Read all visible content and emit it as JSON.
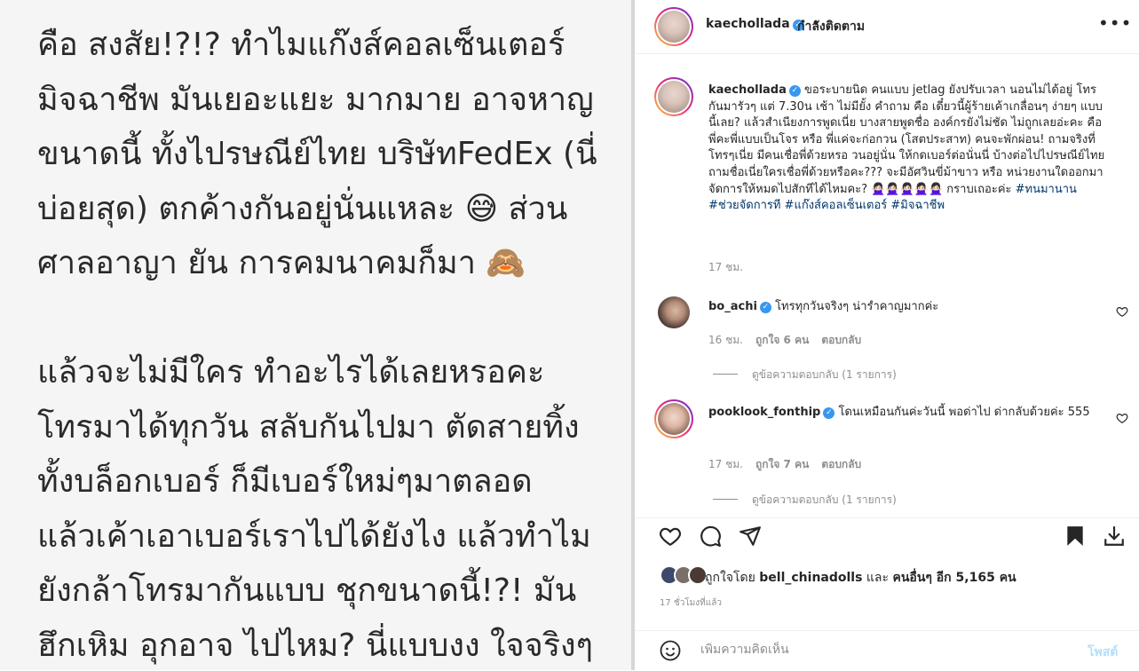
{
  "left_panel": {
    "text": "คือ สงสัย!?!? ทำไมแก๊งส์คอลเซ็นเตอร์\nมิจฉาชีพ มันเยอะแยะ มากมาย อาจหาญ\nขนาดนี้ ทั้งไปรษณีย์ไทย บริษัทFedEx (นี่\nบ่อยสุด) ตกค้างกันอยู่นั่นแหละ 😅 ส่วน\nศาลอาญา ยัน การคมนาคมก็มา 🙈\n\nแล้วจะไม่มีใคร ทำอะไรได้เลยหรอคะ\nโทรมาได้ทุกวัน สลับกันไปมา ตัดสายทิ้ง\nทั้งบล็อกเบอร์ ก็มีเบอร์ใหม่ๆมาตลอด\nแล้วเค้าเอาเบอร์เราไปได้ยังไง แล้วทำไม\nยังกล้าโทรมากันแบบ ชุกขนาดนี้!?! มัน\nฮึกเหิม อุกอาจ ไปไหม? นี่แบบงง ใจจริงๆ"
  },
  "header": {
    "username": "kaechollada",
    "separator": "•",
    "follow_status": "กำลังติดตาม",
    "more_icon": "more-horizontal-icon"
  },
  "caption": {
    "username": "kaechollada",
    "text": "ขอระบายนิด คนแบบ jetlag ยังปรับเวลา นอนไม่ได้อยู่ โทรกันมารัวๆ แต่ 7.30น เช้า ไม่มียั้ง คำถาม คือ เดี๋ยวนี้ผู้ร้ายเค้าเกลื่อนๆ ง่ายๆ แบบนี้เลย? แล้วสำเนียงการพูดเนี่ย บางสายพูดชื่อ องค์กรยังไม่ชัด ไม่ถูกเลยอ่ะคะ คือ พี่คะพี่แบบเป็นโจร หรือ พี่แค่จะก่อกวน (โสตประสาท) คนจะพักผ่อน! ถามจริงที่โทรๆเนี่ย มีคนเชื่อพี่ด้วยหรอ วนอยู่นั่น ให้กดเบอร์ต่อนั่นนี่ บ้างต่อไปไปรษณีย์ไทย ถามชื่อเนี่ยใครเชื่อพี่ด้วยหรือคะ??? จะมีอัศวินขี่ม้าขาว หรือ หน่วยงานใดออกมาจัดการให้หมดไปสักทีได้ไหมคะ? 🙅🏻‍♀️🙅🏻‍♀️🙅🏻‍♀️🙅🏻‍♀️🙅🏻‍♀️ กราบเถอะค่ะ",
    "hashtags": "#ทนมานาน #ช่วยจัดการที #แก๊งส์คอลเซ็นเตอร์ #มิจฉาชีพ",
    "time": "17 ชม."
  },
  "comments": [
    {
      "username": "bo_achi",
      "text": "โทรทุกวันจริงๆ น่ารำคาญมากค่ะ",
      "time": "16 ชม.",
      "likes": "ถูกใจ 6 คน",
      "reply": "ตอบกลับ",
      "view_replies": "ดูข้อความตอบกลับ (1 รายการ)"
    },
    {
      "username": "pooklook_fonthip",
      "text": "โดนเหมือนกันค่ะวันนี้ พอด่าไป ด่ากลับด้วยค่ะ 555",
      "time": "17 ชม.",
      "likes": "ถูกใจ 7 คน",
      "reply": "ตอบกลับ",
      "view_replies": "ดูข้อความตอบกลับ (1 รายการ)"
    }
  ],
  "actions": {
    "like_icon": "heart-icon",
    "comment_icon": "comment-icon",
    "share_icon": "send-icon",
    "save_icon": "bookmark-filled-icon",
    "download_icon": "download-icon"
  },
  "likes": {
    "prefix": "ถูกใจโดย",
    "user": "bell_chinadolls",
    "conj": "และ",
    "others": "คนอื่นๆ อีก 5,165 คน"
  },
  "time_ago": "17 ชั่วโมงที่แล้ว",
  "comment_box": {
    "placeholder": "เพิ่มความคิดเห็น",
    "post_label": "โพสต์"
  },
  "colors": {
    "link": "#00376b",
    "verified": "#3897f0",
    "post_disabled": "#b2dffc"
  }
}
